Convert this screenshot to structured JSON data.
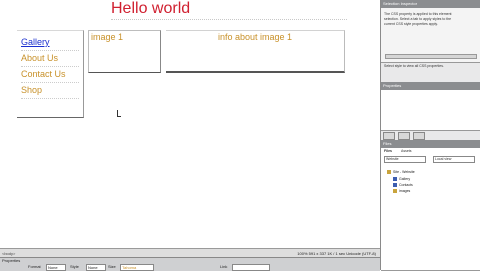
{
  "page": {
    "headline": "Hello world",
    "nav": [
      {
        "label": "Gallery",
        "active": true
      },
      {
        "label": "About Us",
        "active": false
      },
      {
        "label": "Contact Us",
        "active": false
      },
      {
        "label": "Shop",
        "active": false
      }
    ],
    "image_label": "image 1",
    "info_label": "info about image 1"
  },
  "right_panel": {
    "top_head": "Selection Inspector",
    "tiny_lines": [
      "The CSS property is applied to this element",
      "selection. Select a tab to apply styles to the",
      "current CSS style properties apply."
    ],
    "mid_line": "Select style to view all CSS properties.",
    "panel2_head": "Properties",
    "panel3_head": "Files",
    "tabs": [
      "Files",
      "Assets"
    ],
    "site_select": "Website",
    "view_select": "Local view",
    "tree": [
      "Site - Website",
      "Gallery",
      "Contacts",
      "images"
    ]
  },
  "status_bar": {
    "left": "<body>",
    "right": "100%   591 x 337   1K / 1 sec   Unicode (UTF-8)"
  },
  "properties": {
    "head": "Properties",
    "format_label": "Format",
    "format_value": "None",
    "style_label": "Style",
    "style_value": "None",
    "size_label": "Size",
    "size_value": "Tahoma",
    "link_label": "Link"
  }
}
